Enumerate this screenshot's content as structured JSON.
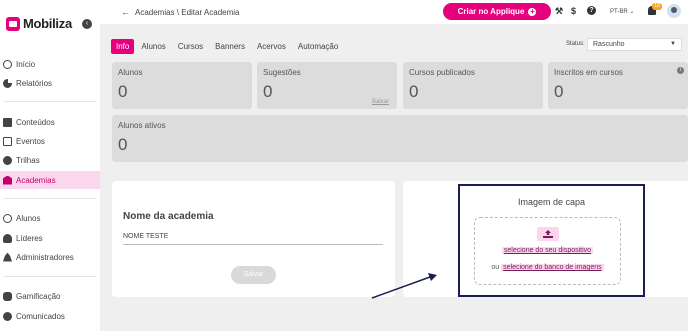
{
  "brand": {
    "name": "Mobiliza",
    "accent": "#e6007e",
    "collapse_icon": "chevron-left-icon"
  },
  "sidebar": {
    "items": [
      {
        "label": "Início",
        "icon": "home-icon"
      },
      {
        "label": "Relatórios",
        "icon": "pie-chart-icon"
      },
      {
        "label": "Conteúdos",
        "icon": "content-icon"
      },
      {
        "label": "Eventos",
        "icon": "calendar-icon"
      },
      {
        "label": "Trilhas",
        "icon": "trail-icon"
      },
      {
        "label": "Academias",
        "icon": "bank-icon",
        "active": true
      },
      {
        "label": "Alunos",
        "icon": "user-icon"
      },
      {
        "label": "Líderes",
        "icon": "users-icon"
      },
      {
        "label": "Administradores",
        "icon": "admin-icon"
      },
      {
        "label": "Gamificação",
        "icon": "gamepad-icon"
      },
      {
        "label": "Comunicados",
        "icon": "chat-icon"
      }
    ]
  },
  "header": {
    "breadcrumb": "Academias \\ Editar Academia",
    "create_button": "Criar no Applique",
    "lang": "PT-BR",
    "notification_count": "18",
    "icons": [
      "wrench-icon",
      "dollar-icon",
      "help-icon",
      "bell-icon",
      "avatar"
    ]
  },
  "tabs": [
    "Info",
    "Alunos",
    "Cursos",
    "Banners",
    "Acervos",
    "Automação"
  ],
  "status": {
    "label": "Status:",
    "value": "Rascunho"
  },
  "stats": [
    {
      "label": "Alunos",
      "value": "0"
    },
    {
      "label": "Sugestões",
      "value": "0",
      "link": "Baixar"
    },
    {
      "label": "Cursos publicados",
      "value": "0"
    },
    {
      "label": "Inscritos em cursos",
      "value": "0"
    },
    {
      "label": "Alunos ativos",
      "value": "0"
    }
  ],
  "form": {
    "title": "Nome da academia",
    "name_value": "NOME TESTE",
    "save_label": "Salvar"
  },
  "cover": {
    "title": "Imagem de capa",
    "link_device": "selecione do seu dispositivo",
    "or_text": "ou",
    "link_bank": "selecione do banco de imagens"
  }
}
